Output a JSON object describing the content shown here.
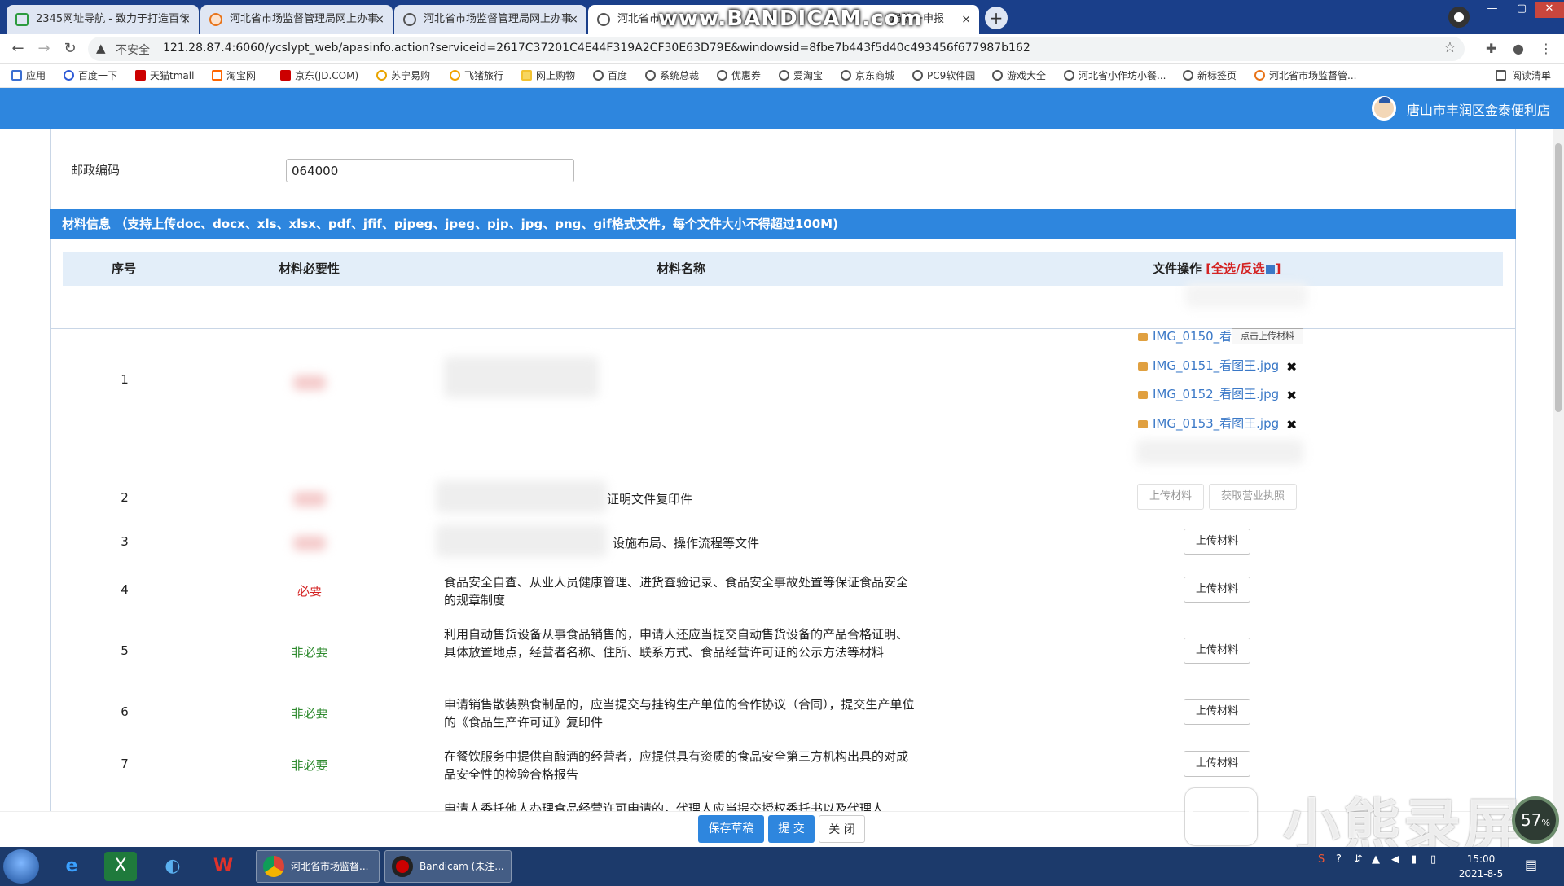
{
  "browser": {
    "tabs": [
      {
        "title": "2345网址导航 - 致力于打造百年"
      },
      {
        "title": "河北省市场监督管理局网上办事"
      },
      {
        "title": "河北省市场监督管理局网上办事"
      },
      {
        "title": "河北省市"
      },
      {
        "title": "局统一申报"
      }
    ],
    "tab_close": "×",
    "new_tab": "+",
    "recorder_watermark": "www.BANDICAM.com",
    "security_label": "不安全",
    "url": "121.28.87.4:6060/ycslypt_web/apasinfo.action?serviceid=2617C37201C4E44F319A2CF30E63D79E&windowsid=8fbe7b443f5d40c493456f677987b162",
    "window_controls": [
      "—",
      "▢",
      "✕"
    ]
  },
  "bookmarks": [
    {
      "label": "应用",
      "icon": "apps-icon"
    },
    {
      "label": "百度一下",
      "icon": "baidu-icon"
    },
    {
      "label": "天猫tmall",
      "icon": "tmall-icon"
    },
    {
      "label": "淘宝网",
      "icon": "taobao-icon"
    },
    {
      "label": "京东(JD.COM)",
      "icon": "jd-icon"
    },
    {
      "label": "苏宁易购",
      "icon": "suning-icon"
    },
    {
      "label": "飞猪旅行",
      "icon": "fliggy-icon"
    },
    {
      "label": "网上购物",
      "icon": "folder-icon"
    },
    {
      "label": "百度",
      "icon": "globe-icon"
    },
    {
      "label": "系统总裁",
      "icon": "globe-icon"
    },
    {
      "label": "优惠券",
      "icon": "globe-icon"
    },
    {
      "label": "爱淘宝",
      "icon": "globe-icon"
    },
    {
      "label": "京东商城",
      "icon": "globe-icon"
    },
    {
      "label": "PC9软件园",
      "icon": "globe-icon"
    },
    {
      "label": "游戏大全",
      "icon": "globe-icon"
    },
    {
      "label": "河北省小作坊小餐...",
      "icon": "globe-icon"
    },
    {
      "label": "新标签页",
      "icon": "globe-icon"
    },
    {
      "label": "河北省市场监督管...",
      "icon": "site-icon"
    }
  ],
  "reading_list": "阅读清单",
  "header": {
    "user_name": "唐山市丰润区金泰便利店"
  },
  "form": {
    "postal_label": "邮政编码",
    "postal_value": "064000"
  },
  "materials": {
    "section_title": "材料信息 （支持上传doc、docx、xls、xlsx、pdf、jfif、pjpeg、jpeg、pjp、jpg、png、gif格式文件，每个文件大小不得超过100M)",
    "headers": {
      "index": "序号",
      "necessity": "材料必要性",
      "name": "材料名称",
      "ops": "文件操作",
      "select_all": "[全选/反选",
      "select_all_end": "]"
    },
    "row1": {
      "index": "1",
      "files": [
        "IMG_0150_看",
        "IMG_0151_看图王.jpg",
        "IMG_0152_看图王.jpg",
        "IMG_0153_看图王.jpg"
      ],
      "tooltip": "点击上传材料",
      "delete": "✖"
    },
    "row2": {
      "index": "2",
      "name": "证明文件复印件",
      "btn_upload": "上传材料",
      "btn_license": "获取营业执照"
    },
    "row3": {
      "index": "3",
      "name": "设施布局、操作流程等文件",
      "btn_upload": "上传材料"
    },
    "rows": [
      {
        "index": "4",
        "necessity": "必要",
        "name": "食品安全自查、从业人员健康管理、进货查验记录、食品安全事故处置等保证食品安全的规章制度",
        "btn": "上传材料"
      },
      {
        "index": "5",
        "necessity": "非必要",
        "name": "利用自动售货设备从事食品销售的，申请人还应当提交自动售货设备的产品合格证明、具体放置地点，经营者名称、住所、联系方式、食品经营许可证的公示方法等材料",
        "btn": "上传材料"
      },
      {
        "index": "6",
        "necessity": "非必要",
        "name": "申请销售散装熟食制品的，应当提交与挂钩生产单位的合作协议（合同），提交生产单位的《食品生产许可证》复印件",
        "btn": "上传材料"
      },
      {
        "index": "7",
        "necessity": "非必要",
        "name": "在餐饮服务中提供自酿酒的经营者，应提供具有资质的食品安全第三方机构出具的对成品安全性的检验合格报告",
        "btn": "上传材料"
      },
      {
        "index": "",
        "necessity": "",
        "name": "申请人委托他人办理食品经营许可申请的，代理人应当提交授权委托书以及代理人",
        "btn": ""
      }
    ]
  },
  "actions": {
    "save_draft": "保存草稿",
    "submit": "提 交",
    "close": "关 闭"
  },
  "watermark": {
    "text": "小熊录屏",
    "percent": "57"
  },
  "taskbar": {
    "apps": [
      {
        "label": "河北省市场监督..."
      },
      {
        "label": "Bandicam (未注..."
      }
    ],
    "time": "15:00",
    "date": "2021-8-5"
  }
}
